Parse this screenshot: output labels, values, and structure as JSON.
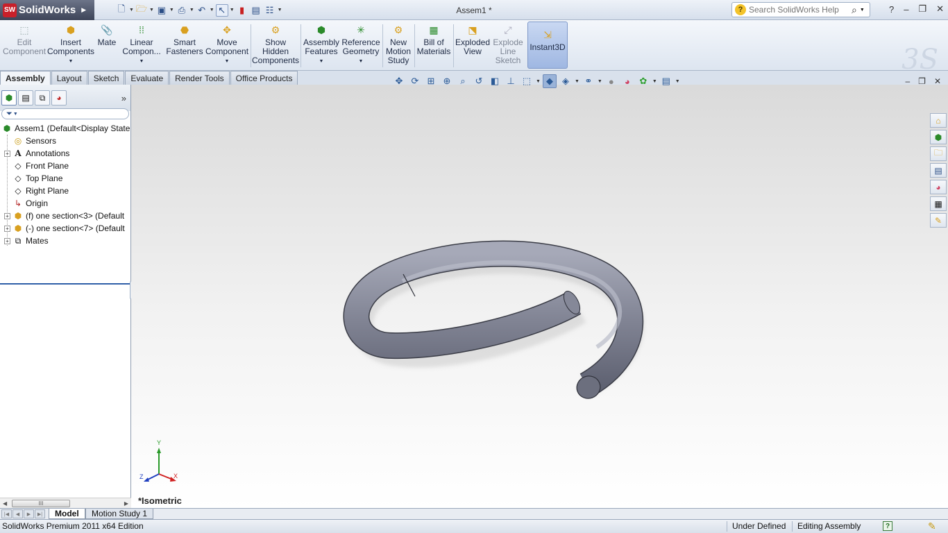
{
  "app": {
    "name": "SolidWorks",
    "logo_mark": "SW",
    "document_title": "Assem1 *"
  },
  "quick_access": [
    {
      "icon": "new-document-icon",
      "glyph": "🗋"
    },
    {
      "icon": "open-folder-icon",
      "glyph": "📂"
    },
    {
      "icon": "save-icon",
      "glyph": "💾"
    },
    {
      "icon": "print-icon",
      "glyph": "🖶"
    },
    {
      "icon": "undo-icon",
      "glyph": "↶"
    },
    {
      "icon": "select-arrow-icon",
      "glyph": "↖"
    },
    {
      "icon": "rebuild-traffic-light-icon",
      "glyph": "🚦"
    },
    {
      "icon": "file-properties-icon",
      "glyph": "📋"
    },
    {
      "icon": "options-icon",
      "glyph": "☰"
    }
  ],
  "search": {
    "placeholder": "Search SolidWorks Help"
  },
  "window_controls": {
    "help": "?",
    "minimize": "–",
    "restore": "❐",
    "close": "✕"
  },
  "commands": {
    "edit_component": "Edit\nComponent",
    "insert_components": "Insert\nComponents",
    "mate": "Mate",
    "linear_component": "Linear\nCompon...",
    "smart_fasteners": "Smart\nFasteners",
    "move_component": "Move\nComponent",
    "show_hidden": "Show\nHidden\nComponents",
    "assembly_features": "Assembly\nFeatures",
    "reference_geometry": "Reference\nGeometry",
    "new_motion_study": "New\nMotion\nStudy",
    "bill_of_materials": "Bill of\nMaterials",
    "exploded_view": "Exploded\nView",
    "explode_line_sketch": "Explode\nLine\nSketch",
    "instant3d": "Instant3D"
  },
  "tabs": [
    "Assembly",
    "Layout",
    "Sketch",
    "Evaluate",
    "Render Tools",
    "Office Products"
  ],
  "feature_tree": {
    "root": "Assem1  (Default<Display State",
    "items": [
      {
        "label": "Sensors",
        "icon": "sensor-icon",
        "glyph": "⌚",
        "expandable": false
      },
      {
        "label": "Annotations",
        "icon": "annotation-icon",
        "glyph": "A",
        "expandable": true
      },
      {
        "label": "Front Plane",
        "icon": "plane-icon",
        "glyph": "◇",
        "expandable": false
      },
      {
        "label": "Top Plane",
        "icon": "plane-icon",
        "glyph": "◇",
        "expandable": false
      },
      {
        "label": "Right Plane",
        "icon": "plane-icon",
        "glyph": "◇",
        "expandable": false
      },
      {
        "label": "Origin",
        "icon": "origin-icon",
        "glyph": "↳",
        "expandable": false
      },
      {
        "label": "(f) one section<3> (Default",
        "icon": "part-icon",
        "glyph": "⬢",
        "expandable": true
      },
      {
        "label": "(-) one section<7> (Default",
        "icon": "part-icon",
        "glyph": "⬢",
        "expandable": true
      },
      {
        "label": "Mates",
        "icon": "mates-icon",
        "glyph": "⧉",
        "expandable": true
      }
    ],
    "scroll_thumb": "III"
  },
  "viewport": {
    "view_label": "*Isometric",
    "triad": {
      "y": "Y",
      "x": "X",
      "z": "Z"
    }
  },
  "bottom_tabs": [
    "Model",
    "Motion Study 1"
  ],
  "status": {
    "edition": "SolidWorks Premium 2011 x64 Edition",
    "state": "Under Defined",
    "mode": "Editing Assembly",
    "help_glyph": "?"
  },
  "colors": {
    "tube": "#7c7f8f",
    "tube_light": "#a6a9b8",
    "accent": "#2f5fa8",
    "logo_red": "#c8202a"
  }
}
